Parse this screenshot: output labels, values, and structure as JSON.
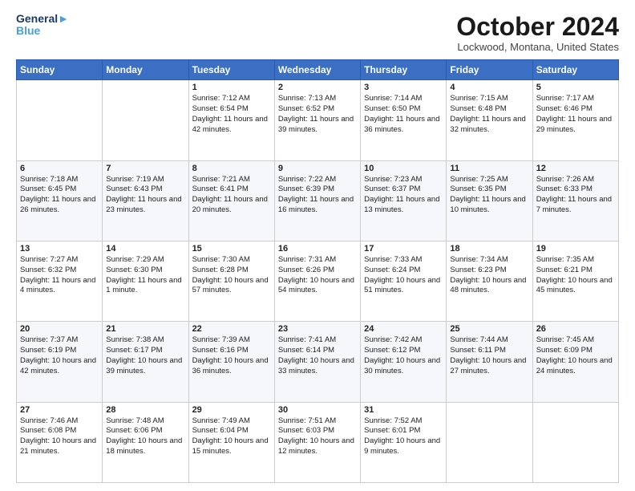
{
  "header": {
    "logo_line1": "General",
    "logo_line2": "Blue",
    "month": "October 2024",
    "location": "Lockwood, Montana, United States"
  },
  "weekdays": [
    "Sunday",
    "Monday",
    "Tuesday",
    "Wednesday",
    "Thursday",
    "Friday",
    "Saturday"
  ],
  "rows": [
    [
      {
        "day": "",
        "text": ""
      },
      {
        "day": "",
        "text": ""
      },
      {
        "day": "1",
        "text": "Sunrise: 7:12 AM\nSunset: 6:54 PM\nDaylight: 11 hours and 42 minutes."
      },
      {
        "day": "2",
        "text": "Sunrise: 7:13 AM\nSunset: 6:52 PM\nDaylight: 11 hours and 39 minutes."
      },
      {
        "day": "3",
        "text": "Sunrise: 7:14 AM\nSunset: 6:50 PM\nDaylight: 11 hours and 36 minutes."
      },
      {
        "day": "4",
        "text": "Sunrise: 7:15 AM\nSunset: 6:48 PM\nDaylight: 11 hours and 32 minutes."
      },
      {
        "day": "5",
        "text": "Sunrise: 7:17 AM\nSunset: 6:46 PM\nDaylight: 11 hours and 29 minutes."
      }
    ],
    [
      {
        "day": "6",
        "text": "Sunrise: 7:18 AM\nSunset: 6:45 PM\nDaylight: 11 hours and 26 minutes."
      },
      {
        "day": "7",
        "text": "Sunrise: 7:19 AM\nSunset: 6:43 PM\nDaylight: 11 hours and 23 minutes."
      },
      {
        "day": "8",
        "text": "Sunrise: 7:21 AM\nSunset: 6:41 PM\nDaylight: 11 hours and 20 minutes."
      },
      {
        "day": "9",
        "text": "Sunrise: 7:22 AM\nSunset: 6:39 PM\nDaylight: 11 hours and 16 minutes."
      },
      {
        "day": "10",
        "text": "Sunrise: 7:23 AM\nSunset: 6:37 PM\nDaylight: 11 hours and 13 minutes."
      },
      {
        "day": "11",
        "text": "Sunrise: 7:25 AM\nSunset: 6:35 PM\nDaylight: 11 hours and 10 minutes."
      },
      {
        "day": "12",
        "text": "Sunrise: 7:26 AM\nSunset: 6:33 PM\nDaylight: 11 hours and 7 minutes."
      }
    ],
    [
      {
        "day": "13",
        "text": "Sunrise: 7:27 AM\nSunset: 6:32 PM\nDaylight: 11 hours and 4 minutes."
      },
      {
        "day": "14",
        "text": "Sunrise: 7:29 AM\nSunset: 6:30 PM\nDaylight: 11 hours and 1 minute."
      },
      {
        "day": "15",
        "text": "Sunrise: 7:30 AM\nSunset: 6:28 PM\nDaylight: 10 hours and 57 minutes."
      },
      {
        "day": "16",
        "text": "Sunrise: 7:31 AM\nSunset: 6:26 PM\nDaylight: 10 hours and 54 minutes."
      },
      {
        "day": "17",
        "text": "Sunrise: 7:33 AM\nSunset: 6:24 PM\nDaylight: 10 hours and 51 minutes."
      },
      {
        "day": "18",
        "text": "Sunrise: 7:34 AM\nSunset: 6:23 PM\nDaylight: 10 hours and 48 minutes."
      },
      {
        "day": "19",
        "text": "Sunrise: 7:35 AM\nSunset: 6:21 PM\nDaylight: 10 hours and 45 minutes."
      }
    ],
    [
      {
        "day": "20",
        "text": "Sunrise: 7:37 AM\nSunset: 6:19 PM\nDaylight: 10 hours and 42 minutes."
      },
      {
        "day": "21",
        "text": "Sunrise: 7:38 AM\nSunset: 6:17 PM\nDaylight: 10 hours and 39 minutes."
      },
      {
        "day": "22",
        "text": "Sunrise: 7:39 AM\nSunset: 6:16 PM\nDaylight: 10 hours and 36 minutes."
      },
      {
        "day": "23",
        "text": "Sunrise: 7:41 AM\nSunset: 6:14 PM\nDaylight: 10 hours and 33 minutes."
      },
      {
        "day": "24",
        "text": "Sunrise: 7:42 AM\nSunset: 6:12 PM\nDaylight: 10 hours and 30 minutes."
      },
      {
        "day": "25",
        "text": "Sunrise: 7:44 AM\nSunset: 6:11 PM\nDaylight: 10 hours and 27 minutes."
      },
      {
        "day": "26",
        "text": "Sunrise: 7:45 AM\nSunset: 6:09 PM\nDaylight: 10 hours and 24 minutes."
      }
    ],
    [
      {
        "day": "27",
        "text": "Sunrise: 7:46 AM\nSunset: 6:08 PM\nDaylight: 10 hours and 21 minutes."
      },
      {
        "day": "28",
        "text": "Sunrise: 7:48 AM\nSunset: 6:06 PM\nDaylight: 10 hours and 18 minutes."
      },
      {
        "day": "29",
        "text": "Sunrise: 7:49 AM\nSunset: 6:04 PM\nDaylight: 10 hours and 15 minutes."
      },
      {
        "day": "30",
        "text": "Sunrise: 7:51 AM\nSunset: 6:03 PM\nDaylight: 10 hours and 12 minutes."
      },
      {
        "day": "31",
        "text": "Sunrise: 7:52 AM\nSunset: 6:01 PM\nDaylight: 10 hours and 9 minutes."
      },
      {
        "day": "",
        "text": ""
      },
      {
        "day": "",
        "text": ""
      }
    ]
  ]
}
